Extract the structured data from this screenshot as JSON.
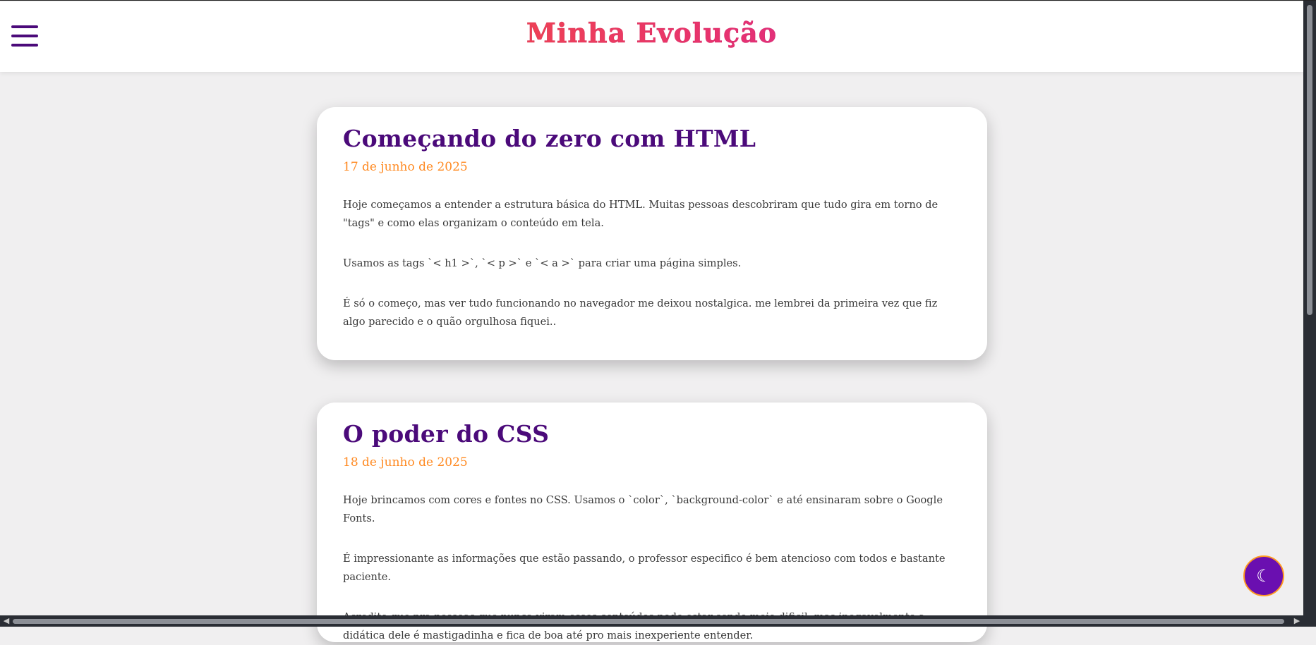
{
  "header": {
    "title": "Minha Evolução",
    "menu_icon": "hamburger-menu-icon"
  },
  "posts": [
    {
      "title": "Começando do zero com HTML",
      "date": "17 de junho de 2025",
      "paragraphs": [
        "Hoje começamos a entender a estrutura básica do HTML. Muitas pessoas descobriram que tudo gira em torno de \"tags\" e como elas organizam o conteúdo em tela.",
        "Usamos as tags `< h1 >`, `< p >` e `< a >` para criar uma página simples.",
        "É só o começo, mas ver tudo funcionando no navegador me deixou nostalgica. me lembrei da primeira vez que fiz algo parecido e o quão orgulhosa fiquei.."
      ]
    },
    {
      "title": "O poder do CSS",
      "date": "18 de junho de 2025",
      "paragraphs": [
        "Hoje brincamos com cores e fontes no CSS. Usamos o `color`, `background-color` e até ensinaram sobre o Google Fonts.",
        "É impressionante as informações que estão passando, o professor especifico é bem atencioso com todos e bastante paciente.",
        "Acredito que pra pessoas que nunca viram esses conteúdos pode estar sendo meio dificil, mas inegavelmente a didática dele é mastigadinha e fica de boa até pro mais inexperiente entender."
      ]
    }
  ],
  "theme_toggle": {
    "icon": "moon-icon",
    "glyph": "☾"
  },
  "colors": {
    "accent_purple": "#4b0a7a",
    "date_orange": "#ff8a22",
    "title_gradient": [
      "#ff6a13",
      "#e8326e",
      "#b11ed6"
    ],
    "toggle_bg": "#6a0fb0"
  }
}
